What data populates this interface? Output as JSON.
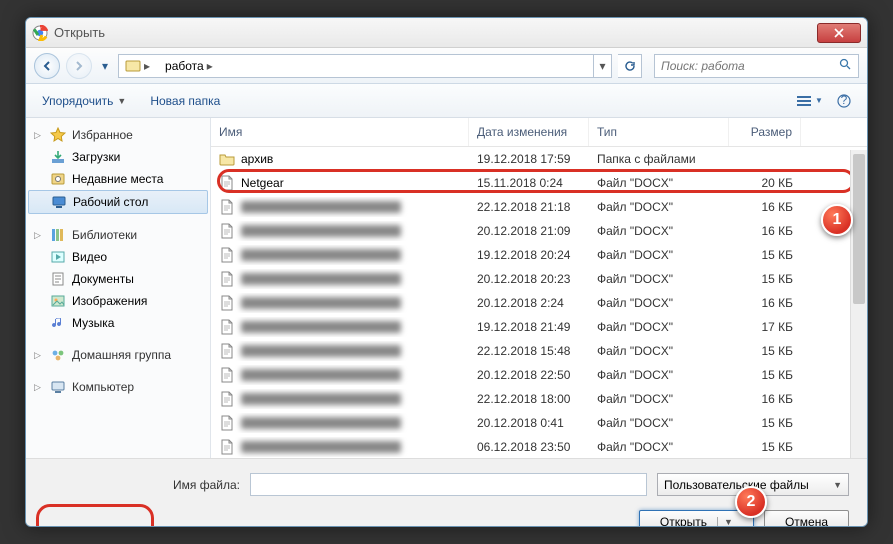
{
  "window": {
    "title": "Открыть"
  },
  "nav": {
    "path_segments": [
      "работа"
    ],
    "search_placeholder": "Поиск: работа"
  },
  "toolbar": {
    "organize": "Упорядочить",
    "new_folder": "Новая папка"
  },
  "sidebar": {
    "favorites": {
      "label": "Избранное",
      "items": [
        {
          "label": "Загрузки",
          "name": "downloads"
        },
        {
          "label": "Недавние места",
          "name": "recent-places"
        },
        {
          "label": "Рабочий стол",
          "name": "desktop",
          "selected": true
        }
      ]
    },
    "libraries": {
      "label": "Библиотеки",
      "items": [
        {
          "label": "Видео",
          "name": "videos"
        },
        {
          "label": "Документы",
          "name": "documents"
        },
        {
          "label": "Изображения",
          "name": "pictures"
        },
        {
          "label": "Музыка",
          "name": "music"
        }
      ]
    },
    "homegroup": {
      "label": "Домашняя группа"
    },
    "computer": {
      "label": "Компьютер"
    }
  },
  "columns": {
    "name": "Имя",
    "date": "Дата изменения",
    "type": "Тип",
    "size": "Размер"
  },
  "rows": [
    {
      "name": "архив",
      "date": "19.12.2018 17:59",
      "type": "Папка с файлами",
      "size": "",
      "folder": true
    },
    {
      "name": "Netgear",
      "date": "15.11.2018 0:24",
      "type": "Файл \"DOCX\"",
      "size": "20 КБ",
      "highlight": true
    },
    {
      "name": "",
      "date": "22.12.2018 21:18",
      "type": "Файл \"DOCX\"",
      "size": "16 КБ",
      "blur": true
    },
    {
      "name": "",
      "date": "20.12.2018 21:09",
      "type": "Файл \"DOCX\"",
      "size": "16 КБ",
      "blur": true
    },
    {
      "name": "",
      "date": "19.12.2018 20:24",
      "type": "Файл \"DOCX\"",
      "size": "15 КБ",
      "blur": true
    },
    {
      "name": "",
      "date": "20.12.2018 20:23",
      "type": "Файл \"DOCX\"",
      "size": "15 КБ",
      "blur": true
    },
    {
      "name": "",
      "date": "20.12.2018 2:24",
      "type": "Файл \"DOCX\"",
      "size": "16 КБ",
      "blur": true
    },
    {
      "name": "",
      "date": "19.12.2018 21:49",
      "type": "Файл \"DOCX\"",
      "size": "17 КБ",
      "blur": true
    },
    {
      "name": "",
      "date": "22.12.2018 15:48",
      "type": "Файл \"DOCX\"",
      "size": "15 КБ",
      "blur": true
    },
    {
      "name": "",
      "date": "20.12.2018 22:50",
      "type": "Файл \"DOCX\"",
      "size": "15 КБ",
      "blur": true
    },
    {
      "name": "",
      "date": "22.12.2018 18:00",
      "type": "Файл \"DOCX\"",
      "size": "16 КБ",
      "blur": true
    },
    {
      "name": "",
      "date": "20.12.2018 0:41",
      "type": "Файл \"DOCX\"",
      "size": "15 КБ",
      "blur": true
    },
    {
      "name": "",
      "date": "06.12.2018 23:50",
      "type": "Файл \"DOCX\"",
      "size": "15 КБ",
      "blur": true
    }
  ],
  "footer": {
    "filename_label": "Имя файла:",
    "filetype": "Пользовательские файлы",
    "open": "Открыть",
    "cancel": "Отмена"
  },
  "callouts": {
    "one": "1",
    "two": "2"
  }
}
